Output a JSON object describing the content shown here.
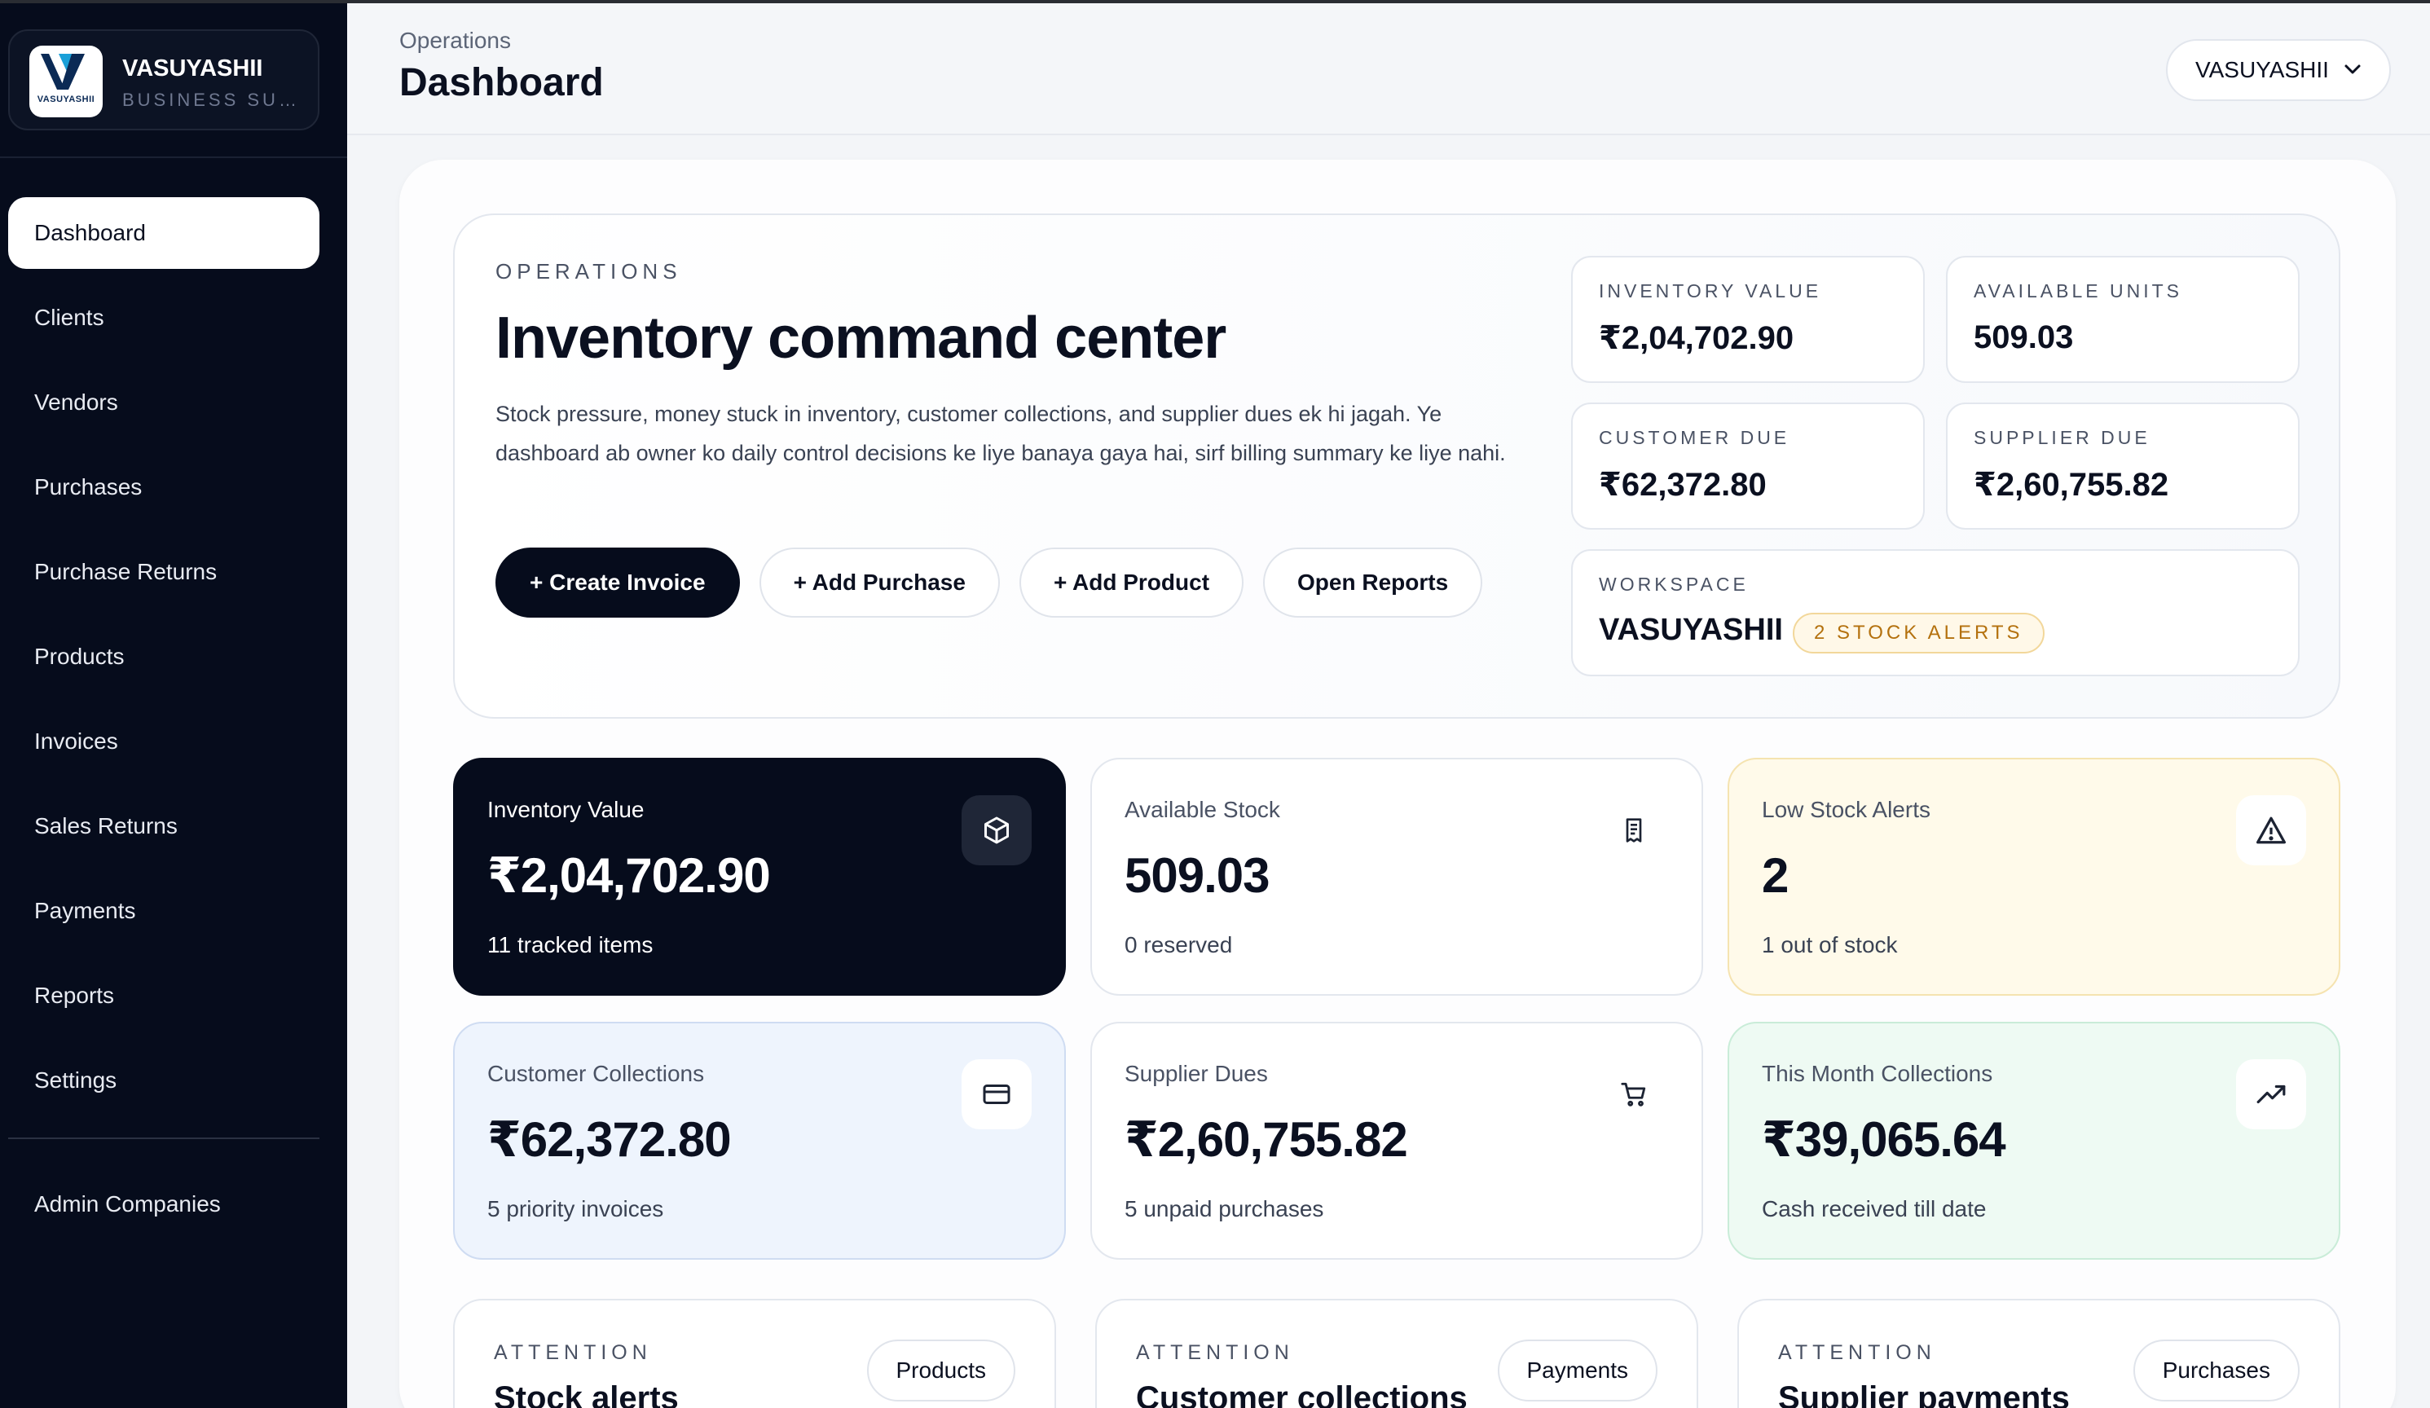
{
  "brand": {
    "name": "VASUYASHII",
    "subtitle": "BUSINESS SUITE",
    "logo_text": "VASUYASHII"
  },
  "sidebar": {
    "items": [
      {
        "label": "Dashboard",
        "active": true
      },
      {
        "label": "Clients"
      },
      {
        "label": "Vendors"
      },
      {
        "label": "Purchases"
      },
      {
        "label": "Purchase Returns"
      },
      {
        "label": "Products"
      },
      {
        "label": "Invoices"
      },
      {
        "label": "Sales Returns"
      },
      {
        "label": "Payments"
      },
      {
        "label": "Reports"
      },
      {
        "label": "Settings"
      }
    ],
    "admin_item": "Admin Companies"
  },
  "header": {
    "breadcrumb": "Operations",
    "title": "Dashboard",
    "workspace_select": "VASUYASHII"
  },
  "hero": {
    "eyebrow": "OPERATIONS",
    "title": "Inventory command center",
    "description": "Stock pressure, money stuck in inventory, customer collections, and supplier dues ek hi jagah. Ye dashboard ab owner ko daily control decisions ke liye banaya gaya hai, sirf billing summary ke liye nahi.",
    "actions": {
      "create_invoice": "+ Create Invoice",
      "add_purchase": "+ Add Purchase",
      "add_product": "+ Add Product",
      "open_reports": "Open Reports"
    },
    "metrics": {
      "inventory_value": {
        "label": "INVENTORY VALUE",
        "value": "₹2,04,702.90"
      },
      "available_units": {
        "label": "AVAILABLE UNITS",
        "value": "509.03"
      },
      "customer_due": {
        "label": "CUSTOMER DUE",
        "value": "₹62,372.80"
      },
      "supplier_due": {
        "label": "SUPPLIER DUE",
        "value": "₹2,60,755.82"
      }
    },
    "workspace": {
      "label": "WORKSPACE",
      "name": "VASUYASHII",
      "alerts": "2 STOCK ALERTS"
    }
  },
  "cards": {
    "inventory_value": {
      "label": "Inventory Value",
      "value": "₹2,04,702.90",
      "sub": "11 tracked items",
      "icon": "cube-icon"
    },
    "available_stock": {
      "label": "Available Stock",
      "value": "509.03",
      "sub": "0 reserved",
      "icon": "receipt-icon"
    },
    "low_stock": {
      "label": "Low Stock Alerts",
      "value": "2",
      "sub": "1 out of stock",
      "icon": "warning-icon"
    },
    "customer_collections": {
      "label": "Customer Collections",
      "value": "₹62,372.80",
      "sub": "5 priority invoices",
      "icon": "card-icon"
    },
    "supplier_dues": {
      "label": "Supplier Dues",
      "value": "₹2,60,755.82",
      "sub": "5 unpaid purchases",
      "icon": "cart-icon"
    },
    "month_collections": {
      "label": "This Month Collections",
      "value": "₹39,065.64",
      "sub": "Cash received till date",
      "icon": "trend-up-icon"
    }
  },
  "attention": [
    {
      "eyebrow": "ATTENTION",
      "title": "Stock alerts",
      "link": "Products"
    },
    {
      "eyebrow": "ATTENTION",
      "title": "Customer collections",
      "link": "Payments"
    },
    {
      "eyebrow": "ATTENTION",
      "title": "Supplier payments",
      "link": "Purchases"
    }
  ],
  "colors": {
    "sidebar_bg": "#060c1c",
    "primary": "#060c1c",
    "alert_amber": "#b4710e",
    "low_stock_bg": "#fffaea",
    "collections_bg": "#eef4fd",
    "month_bg": "#eefaf3"
  }
}
